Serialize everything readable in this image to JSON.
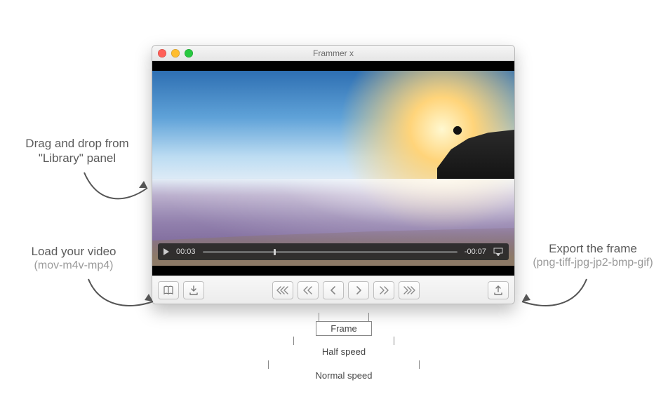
{
  "window": {
    "title": "Frammer x"
  },
  "playback": {
    "elapsed": "00:03",
    "remaining": "-00:07"
  },
  "toolbar": {
    "library_tip": "Library",
    "load_tip": "Load",
    "rew3_tip": "Rewind normal speed",
    "rew2_tip": "Rewind half speed",
    "rew1_tip": "Previous frame",
    "fwd1_tip": "Next frame",
    "fwd2_tip": "Forward half speed",
    "fwd3_tip": "Forward normal speed",
    "export_tip": "Export"
  },
  "callouts": {
    "drag_title": "Drag and drop from",
    "drag_sub": "\"Library\" panel",
    "load_title": "Load your video",
    "load_sub": "(mov-m4v-mp4)",
    "export_title": "Export the frame",
    "export_sub": "(png-tiff-jpg-jp2-bmp-gif)"
  },
  "diagram": {
    "frame": "Frame",
    "half": "Half speed",
    "normal": "Normal speed"
  }
}
